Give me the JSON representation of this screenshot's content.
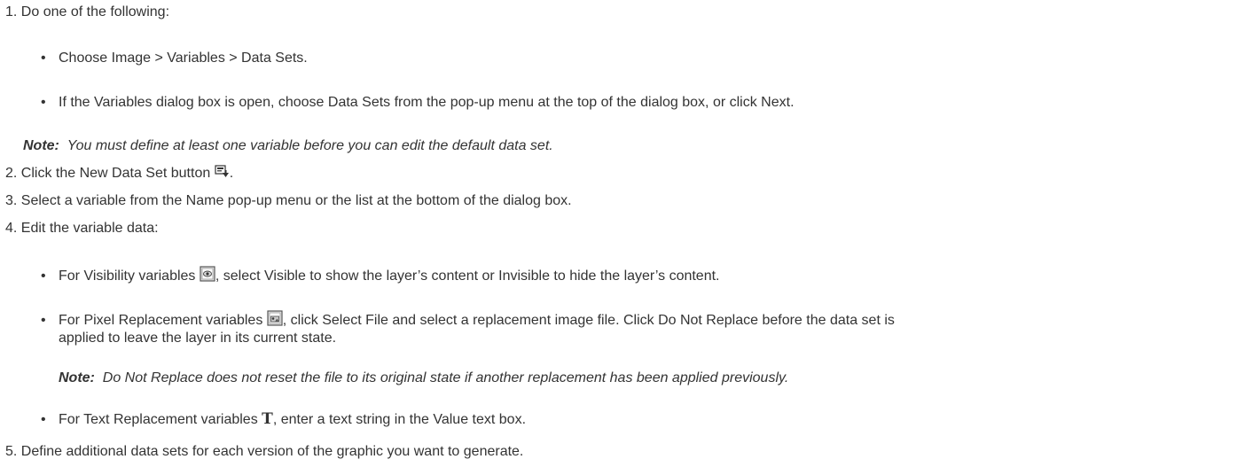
{
  "steps": [
    {
      "num": "1.",
      "text": "Do one of the following:"
    },
    {
      "num": "2.",
      "text_before": "Click the New Data Set button",
      "text_after": "."
    },
    {
      "num": "3.",
      "text": "Select a variable from the Name pop-up menu or the list at the bottom of the dialog box."
    },
    {
      "num": "4.",
      "text": "Edit the variable data:"
    },
    {
      "num": "5.",
      "text": "Define additional data sets for each version of the graphic you want to generate."
    }
  ],
  "step1_bullets": [
    "Choose Image > Variables > Data Sets.",
    "If the Variables dialog box is open, choose Data Sets from the pop-up menu at the top of the dialog box, or click Next."
  ],
  "note1": {
    "label": "Note:",
    "text": "You must define at least one variable before you can edit the default data set."
  },
  "step4_bullets": {
    "visibility": {
      "before": "For Visibility variables",
      "after": ", select Visible to show the layer’s content or Invisible to hide the layer’s content."
    },
    "pixel": {
      "before": "For Pixel Replacement variables",
      "after": ", click Select File and select a replacement image file. Click Do Not Replace before the data set is",
      "line2": "applied to leave the layer in its current state."
    },
    "text": {
      "before": "For Text Replacement variables",
      "icon_glyph": "T",
      "after": ", enter a text string in the Value text box."
    }
  },
  "note2": {
    "label": "Note:",
    "text": "Do Not Replace does not reset the file to its original state if another replacement has been applied previously."
  },
  "bullet_glyph": "•",
  "icons": [
    "new-data-set-icon",
    "visibility-variable-icon",
    "pixel-replacement-icon",
    "text-replacement-icon"
  ]
}
